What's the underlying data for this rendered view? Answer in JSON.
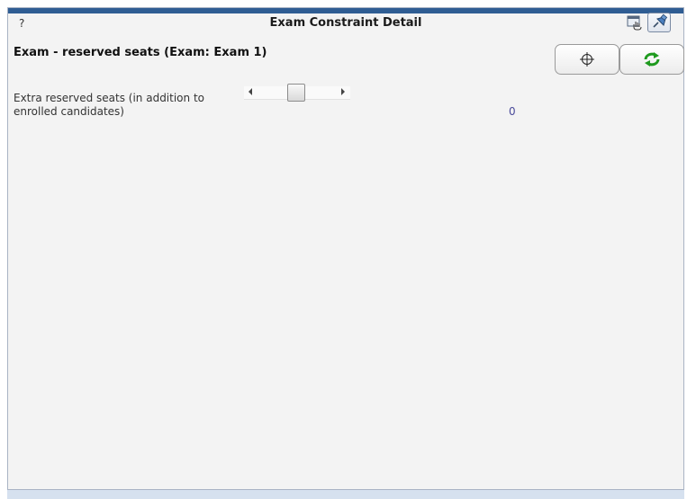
{
  "window": {
    "help_label": "?",
    "title": "Exam Constraint Detail",
    "detach_icon": "detach-window-icon",
    "pin_icon": "pin-icon"
  },
  "section": {
    "title": "Exam - reserved seats (Exam: Exam 1)"
  },
  "actions": {
    "locate_icon": "crosshair-icon",
    "refresh_icon": "refresh-icon",
    "refresh_color": "#1e9a1e"
  },
  "field": {
    "label": "Extra reserved seats (in addition to enrolled candidates)",
    "value": "0",
    "slider_fraction": 0.24
  },
  "colors": {
    "accent": "#2f5d93",
    "panel_bg": "#f3f3f3",
    "value_text": "#4a4a9a"
  }
}
